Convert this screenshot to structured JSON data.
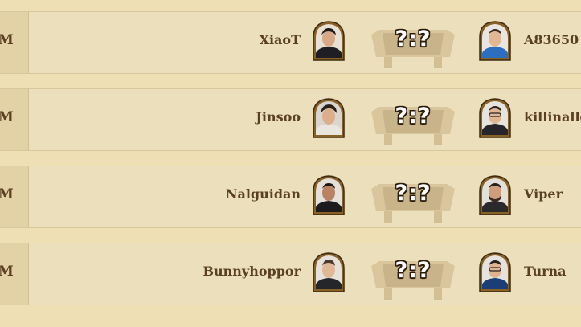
{
  "matches": [
    {
      "time_suffix": "M",
      "left_player": "XiaoT",
      "right_player": "A83650",
      "score": "?:?"
    },
    {
      "time_suffix": "M",
      "left_player": "Jinsoo",
      "right_player": "killinallday",
      "score": "?:?"
    },
    {
      "time_suffix": "M",
      "left_player": "Nalguidan",
      "right_player": "Viper",
      "score": "?:?"
    },
    {
      "time_suffix": "M",
      "left_player": "Bunnyhoppor",
      "right_player": "Turna",
      "score": "?:?"
    }
  ],
  "icons": {
    "portrait": "player-portrait-icon",
    "score_frame": "score-frame-icon"
  },
  "colors": {
    "background": "#efdfb5",
    "row": "#ece0bc",
    "text": "#5a3f22",
    "portrait_frame": "#b8893a"
  }
}
